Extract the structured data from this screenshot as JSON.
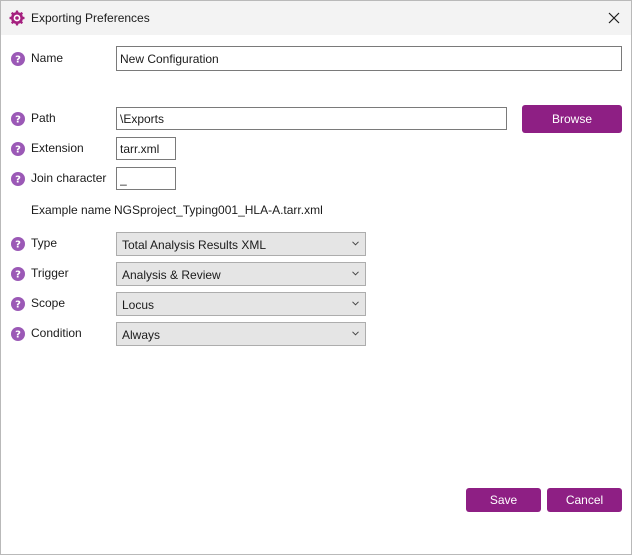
{
  "window": {
    "title": "Exporting Preferences",
    "accent": "#8e1f84"
  },
  "form": {
    "name": {
      "label": "Name",
      "value": "New Configuration"
    },
    "path": {
      "label": "Path",
      "value": "\\Exports"
    },
    "extension": {
      "label": "Extension",
      "value": "tarr.xml"
    },
    "join_character": {
      "label": "Join character",
      "value": "_"
    },
    "example_name": {
      "label": "Example name",
      "value": "NGSproject_Typing001_HLA-A.tarr.xml"
    },
    "type": {
      "label": "Type",
      "value": "Total Analysis Results XML"
    },
    "trigger": {
      "label": "Trigger",
      "value": "Analysis & Review"
    },
    "scope": {
      "label": "Scope",
      "value": "Locus"
    },
    "condition": {
      "label": "Condition",
      "value": "Always"
    }
  },
  "buttons": {
    "browse": "Browse",
    "save": "Save",
    "cancel": "Cancel"
  }
}
